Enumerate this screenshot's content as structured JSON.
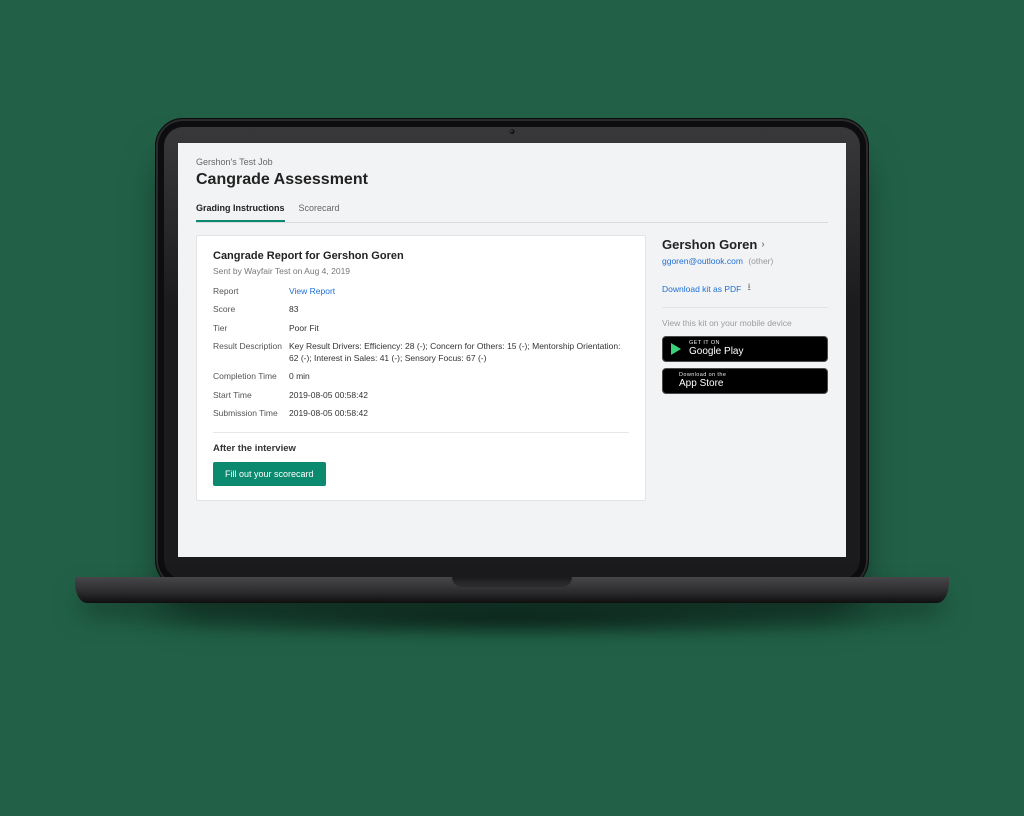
{
  "breadcrumb": "Gershon's Test Job",
  "page_title": "Cangrade Assessment",
  "tabs": [
    {
      "label": "Grading Instructions",
      "active": true
    },
    {
      "label": "Scorecard",
      "active": false
    }
  ],
  "report": {
    "heading": "Cangrade Report for Gershon Goren",
    "sent_by": "Sent by Wayfair Test on Aug 4, 2019",
    "rows": {
      "report_label": "Report",
      "report_link": "View Report",
      "score_label": "Score",
      "score_value": "83",
      "tier_label": "Tier",
      "tier_value": "Poor Fit",
      "result_label": "Result Description",
      "result_value": "Key Result Drivers: Efficiency: 28 (-); Concern for Others: 15 (-); Mentorship Orientation: 62 (-); Interest in Sales: 41 (-); Sensory Focus: 67 (-)",
      "completion_label": "Completion Time",
      "completion_value": "0 min",
      "start_label": "Start Time",
      "start_value": "2019-08-05 00:58:42",
      "submission_label": "Submission Time",
      "submission_value": "2019-08-05 00:58:42"
    },
    "after_heading": "After the interview",
    "scorecard_button": "Fill out your scorecard"
  },
  "sidebar": {
    "candidate_name": "Gershon Goren",
    "email": "ggoren@outlook.com",
    "email_tag": "(other)",
    "download_link": "Download kit as PDF",
    "mobile_hint": "View this kit on your mobile device",
    "google_play": {
      "top": "GET IT ON",
      "bottom": "Google Play"
    },
    "app_store": {
      "top": "Download on the",
      "bottom": "App Store"
    }
  }
}
